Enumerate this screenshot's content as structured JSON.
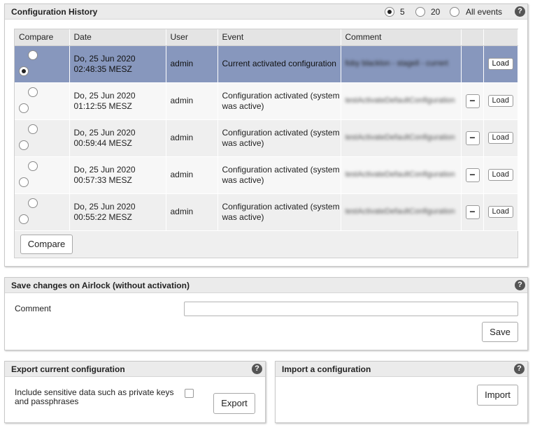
{
  "history": {
    "title": "Configuration History",
    "filters": [
      {
        "label": "5",
        "checked": true
      },
      {
        "label": "20",
        "checked": false
      },
      {
        "label": "All events",
        "checked": false
      }
    ],
    "help_icon": "?",
    "columns": [
      "Compare",
      "Date",
      "User",
      "Event",
      "Comment"
    ],
    "rows": [
      {
        "date": "Do, 25 Jun 2020 02:48:35 MESZ",
        "user": "admin",
        "event": "Current activated configuration",
        "comment": "foby blacklon - stagell - currert",
        "minus": "",
        "load": "Load",
        "active": true
      },
      {
        "date": "Do, 25 Jun 2020 01:12:55 MESZ",
        "user": "admin",
        "event": "Configuration activated (system was active)",
        "comment": "testActivateDefaultConfiguration",
        "minus": "−",
        "load": "Load",
        "active": false
      },
      {
        "date": "Do, 25 Jun 2020 00:59:44 MESZ",
        "user": "admin",
        "event": "Configuration activated (system was active)",
        "comment": "testActivateDefaultConfiguration",
        "minus": "−",
        "load": "Load",
        "active": false
      },
      {
        "date": "Do, 25 Jun 2020 00:57:33 MESZ",
        "user": "admin",
        "event": "Configuration activated (system was active)",
        "comment": "testActivateDefaultConfiguration",
        "minus": "−",
        "load": "Load",
        "active": false
      },
      {
        "date": "Do, 25 Jun 2020 00:55:22 MESZ",
        "user": "admin",
        "event": "Configuration activated (system was active)",
        "comment": "testActivateDefaultConfiguration",
        "minus": "−",
        "load": "Load",
        "active": false
      }
    ],
    "compare_button": "Compare"
  },
  "save": {
    "title": "Save changes on Airlock (without activation)",
    "comment_label": "Comment",
    "comment_value": "",
    "save_button": "Save"
  },
  "export": {
    "title": "Export current configuration",
    "checkbox_label": "Include sensitive data such as private keys and passphrases",
    "checkbox_checked": false,
    "export_button": "Export"
  },
  "import": {
    "title": "Import a configuration",
    "import_button": "Import"
  }
}
